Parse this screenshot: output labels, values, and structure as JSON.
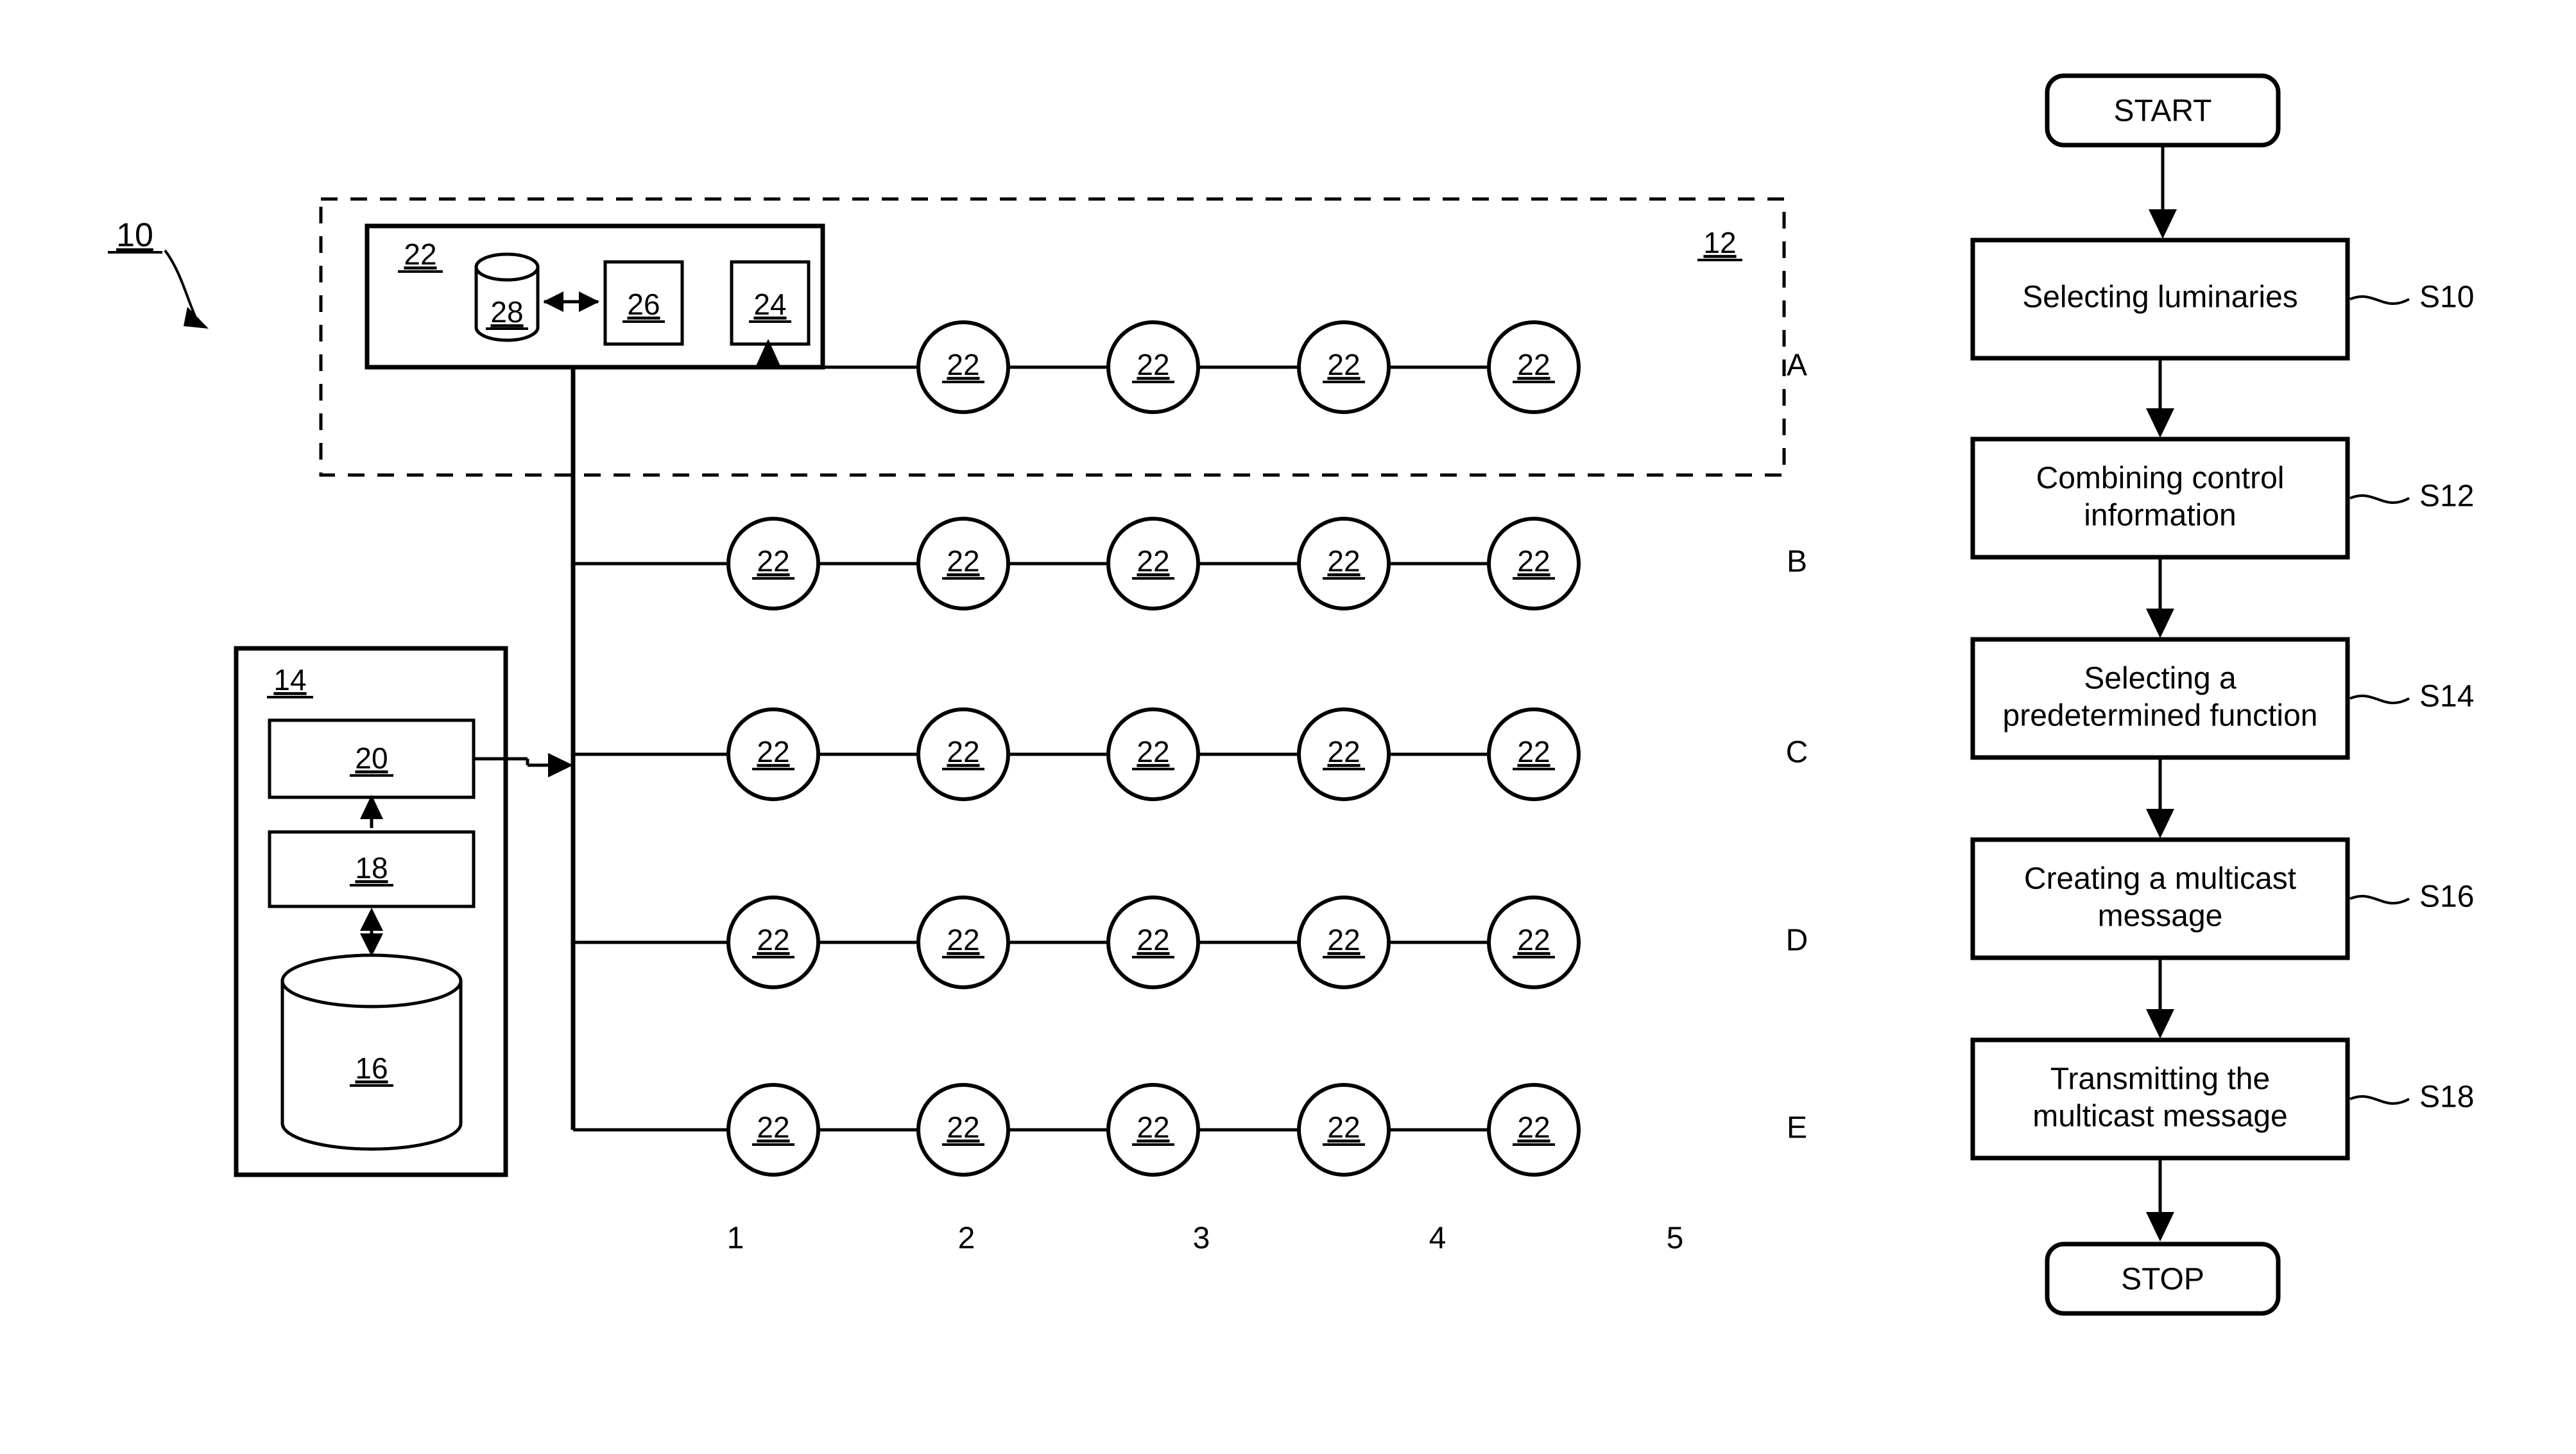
{
  "figure": {
    "system_label": "10",
    "network_region_label": "12",
    "controller_box_label": "14",
    "controller_storage_label": "16",
    "controller_mid_label": "18",
    "controller_top_label": "20",
    "luminaire_label": "22",
    "luminaire_detail": {
      "device_label": "22",
      "receiver_label": "24",
      "processor_label": "26",
      "memory_label": "28"
    },
    "grid": {
      "row_labels": [
        "A",
        "B",
        "C",
        "D",
        "E"
      ],
      "column_labels": [
        "1",
        "2",
        "3",
        "4",
        "5"
      ],
      "node_value": "22",
      "rows": [
        {
          "label": "A",
          "nodes": [
            "",
            "22",
            "22",
            "22",
            "22"
          ]
        },
        {
          "label": "B",
          "nodes": [
            "22",
            "22",
            "22",
            "22",
            "22"
          ]
        },
        {
          "label": "C",
          "nodes": [
            "22",
            "22",
            "22",
            "22",
            "22"
          ]
        },
        {
          "label": "D",
          "nodes": [
            "22",
            "22",
            "22",
            "22",
            "22"
          ]
        },
        {
          "label": "E",
          "nodes": [
            "22",
            "22",
            "22",
            "22",
            "22"
          ]
        }
      ]
    }
  },
  "flowchart": {
    "start_label": "START",
    "stop_label": "STOP",
    "steps": [
      {
        "text_line1": "Selecting luminaries",
        "text_line2": "",
        "step_id": "S10"
      },
      {
        "text_line1": "Combining control",
        "text_line2": "information",
        "step_id": "S12"
      },
      {
        "text_line1": "Selecting a",
        "text_line2": "predetermined function",
        "step_id": "S14"
      },
      {
        "text_line1": "Creating a multicast",
        "text_line2": "message",
        "step_id": "S16"
      },
      {
        "text_line1": "Transmitting the",
        "text_line2": "multicast message",
        "step_id": "S18"
      }
    ]
  },
  "colors": {
    "ink": "#000000",
    "paper": "#ffffff"
  }
}
